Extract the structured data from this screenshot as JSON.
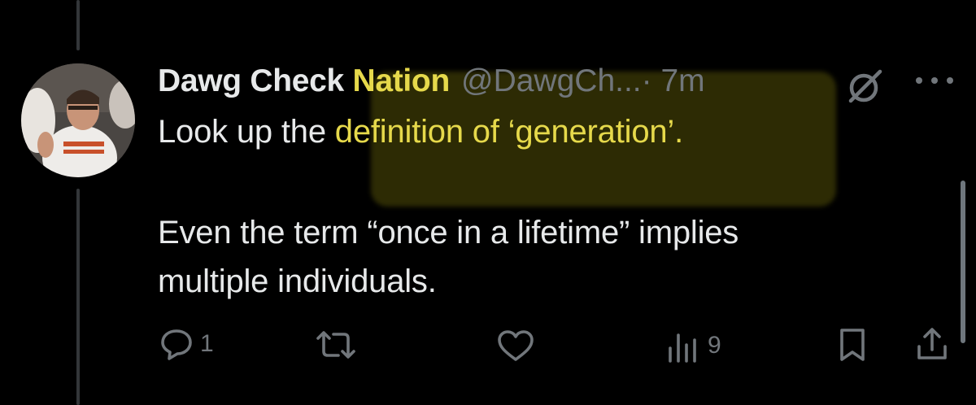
{
  "tweet": {
    "display_name_part1": "Dawg Check ",
    "display_name_part2": "Nation",
    "handle": "@DawgCh...",
    "time": "· 7m",
    "line1_prefix": "Look up the ",
    "line1_highlight": "definition of ‘generation’.",
    "line2": "Even the term “once in a lifetime” implies",
    "line3": "multiple individuals."
  },
  "actions": {
    "reply_count": "1",
    "views_count": "9"
  },
  "icons": {
    "reply": "reply-icon",
    "retweet": "retweet-icon",
    "like": "heart-icon",
    "views": "views-icon",
    "bookmark": "bookmark-icon",
    "share": "share-icon",
    "grok": "grok-icon",
    "more": "more-icon"
  },
  "colors": {
    "background": "#000000",
    "text": "#e7e9ea",
    "muted": "#71767b",
    "highlight_text": "#e6d94b"
  }
}
